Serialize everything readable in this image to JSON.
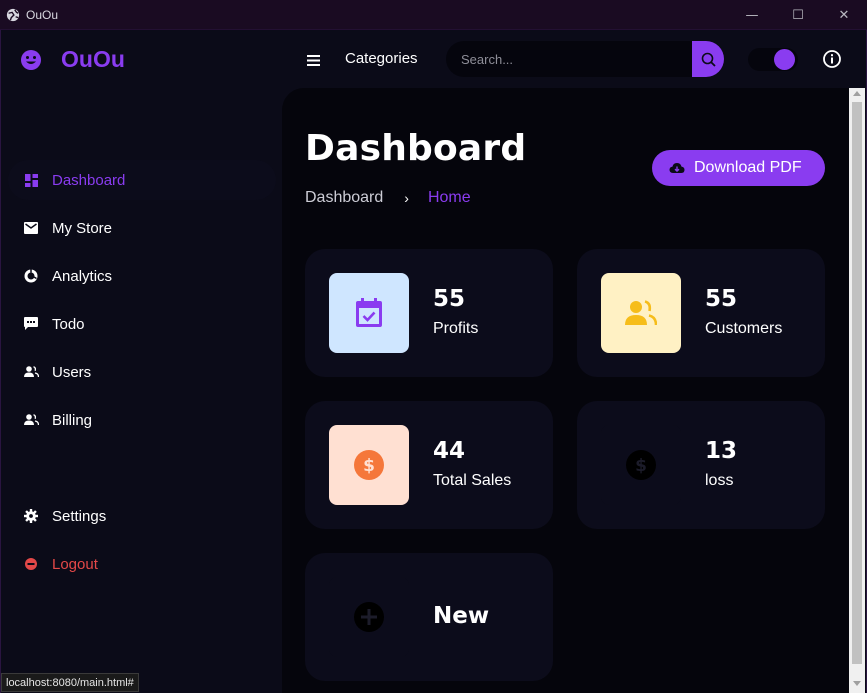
{
  "window": {
    "title": "OuOu",
    "buttons": {
      "minimize": "—",
      "maximize": "☐",
      "close": "✕"
    }
  },
  "header": {
    "brand": "OuOu",
    "categories_label": "Categories",
    "search_placeholder": "Search...",
    "theme_toggle_on": true
  },
  "sidebar": {
    "items": [
      {
        "label": "Dashboard",
        "icon": "grid-icon",
        "active": true
      },
      {
        "label": "My Store",
        "icon": "mail-icon"
      },
      {
        "label": "Analytics",
        "icon": "donut-chart-icon"
      },
      {
        "label": "Todo",
        "icon": "chat-icon"
      },
      {
        "label": "Users",
        "icon": "users-icon"
      },
      {
        "label": "Billing",
        "icon": "users-icon"
      },
      {
        "label": "Settings",
        "icon": "gear-icon"
      },
      {
        "label": "Logout",
        "icon": "logout-icon"
      }
    ]
  },
  "main": {
    "title": "Dashboard",
    "breadcrumb": {
      "first": "Dashboard",
      "separator": "›",
      "current": "Home"
    },
    "download_label": "Download PDF",
    "cards": [
      {
        "value": "55",
        "label": "Profits",
        "icon": "calendar-check-icon",
        "tile_color": "#cfe6ff",
        "icon_color": "#8a3cf0"
      },
      {
        "value": "55",
        "label": "Customers",
        "icon": "users-icon",
        "tile_color": "#fff1c4",
        "icon_color": "#f6bd1a"
      },
      {
        "value": "44",
        "label": "Total Sales",
        "icon": "dollar-circle-icon",
        "tile_color": "#ffe0d2",
        "icon_color": "#f5773a"
      },
      {
        "value": "13",
        "label": "loss",
        "icon": "dollar-circle-icon",
        "tile_color": "#0c0c1b",
        "icon_color": "#000000"
      },
      {
        "label": "New",
        "icon": "plus-circle-icon"
      }
    ]
  },
  "status_url": "localhost:8080/main.html#",
  "colors": {
    "accent": "#8a3cf0",
    "danger": "#e34848",
    "background": "#05050c",
    "card": "#0c0c1b"
  }
}
